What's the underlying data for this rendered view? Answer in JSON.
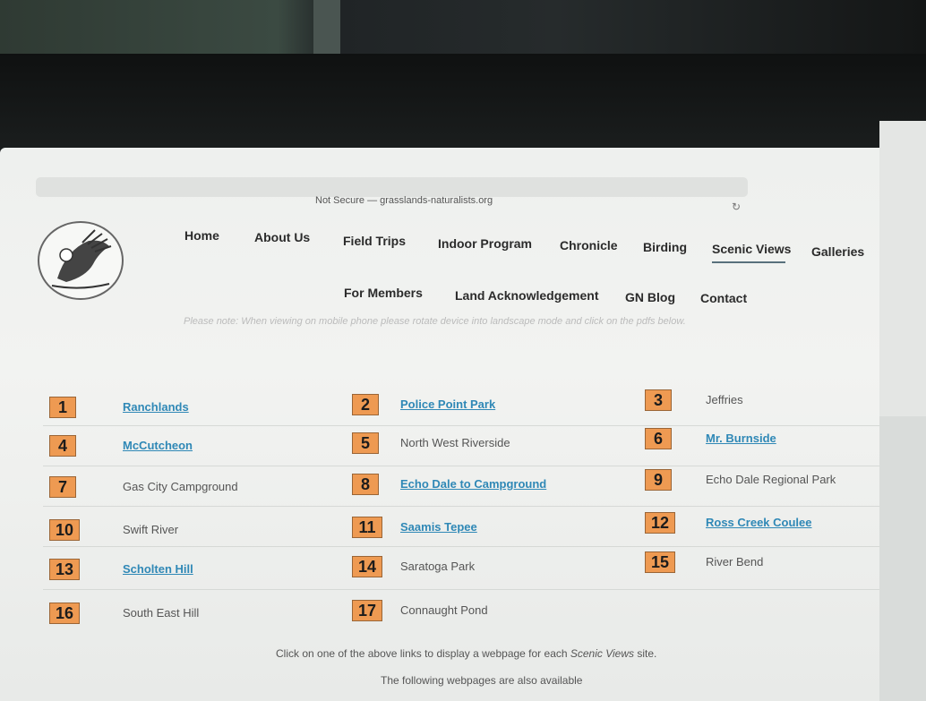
{
  "browser": {
    "url": "Not Secure — grasslands-naturalists.org"
  },
  "nav": {
    "row1": [
      "Home",
      "About Us",
      "Field Trips",
      "Indoor Program",
      "Chronicle",
      "Birding",
      "Scenic Views",
      "Galleries"
    ],
    "row2": [
      "For Members",
      "Land Acknowledgement",
      "GN Blog",
      "Contact"
    ],
    "active": "Scenic Views"
  },
  "note": "Please note: When viewing on mobile phone please rotate device into landscape mode and click on the pdfs below.",
  "sites": [
    {
      "num": "1",
      "name": "Ranchlands",
      "link": true
    },
    {
      "num": "2",
      "name": "Police Point Park",
      "link": true
    },
    {
      "num": "3",
      "name": "Jeffries",
      "link": false
    },
    {
      "num": "4",
      "name": "McCutcheon",
      "link": true
    },
    {
      "num": "5",
      "name": "North West Riverside",
      "link": false
    },
    {
      "num": "6",
      "name": "Mr. Burnside",
      "link": true
    },
    {
      "num": "7",
      "name": "Gas City Campground",
      "link": false
    },
    {
      "num": "8",
      "name": "Echo Dale to Campground",
      "link": true
    },
    {
      "num": "9",
      "name": "Echo Dale Regional Park",
      "link": false
    },
    {
      "num": "10",
      "name": "Swift River",
      "link": false
    },
    {
      "num": "11",
      "name": "Saamis Tepee",
      "link": true
    },
    {
      "num": "12",
      "name": "Ross Creek Coulee",
      "link": true
    },
    {
      "num": "13",
      "name": "Scholten Hill",
      "link": true
    },
    {
      "num": "14",
      "name": "Saratoga Park",
      "link": false
    },
    {
      "num": "15",
      "name": "River Bend",
      "link": false
    },
    {
      "num": "16",
      "name": "South East Hill",
      "link": false
    },
    {
      "num": "17",
      "name": "Connaught Pond",
      "link": false
    }
  ],
  "footer": {
    "line1_before": "Click on one of the above links to display a webpage for each ",
    "line1_em": "Scenic Views",
    "line1_after": " site.",
    "line2": "The following webpages are also available"
  },
  "colors": {
    "badge": "#ee9a52",
    "link": "#2f88b6"
  }
}
